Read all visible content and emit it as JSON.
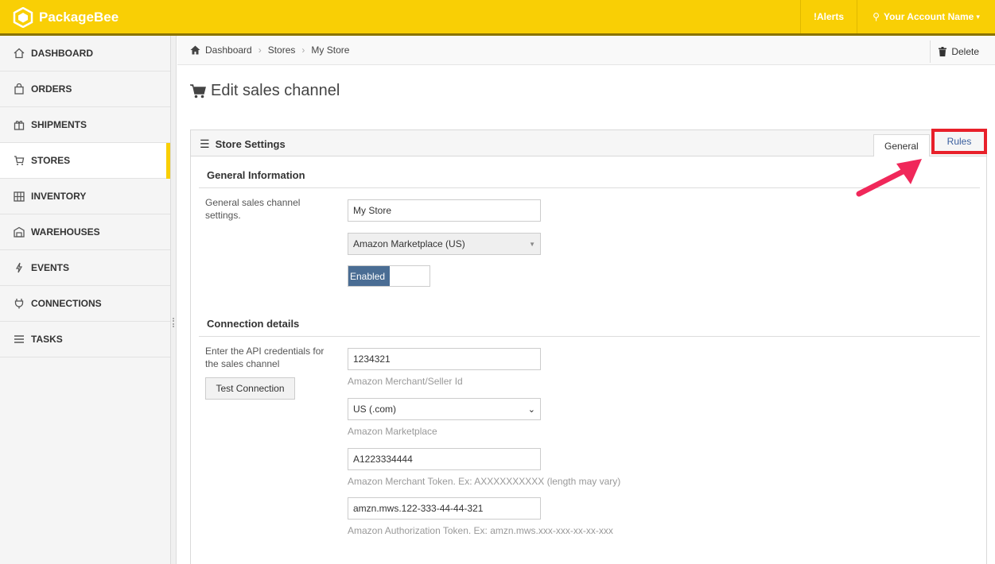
{
  "header": {
    "brand": "PackageBee",
    "alerts_label": "Alerts",
    "account_label": "Your Account Name",
    "brand_color": "#f9cf05"
  },
  "sidebar": {
    "items": [
      {
        "label": "DASHBOARD",
        "icon": "home-icon"
      },
      {
        "label": "ORDERS",
        "icon": "bag-icon"
      },
      {
        "label": "SHIPMENTS",
        "icon": "gift-icon"
      },
      {
        "label": "STORES",
        "icon": "cart-icon",
        "active": true
      },
      {
        "label": "INVENTORY",
        "icon": "inventory-icon"
      },
      {
        "label": "WAREHOUSES",
        "icon": "warehouse-icon"
      },
      {
        "label": "EVENTS",
        "icon": "bolt-icon"
      },
      {
        "label": "CONNECTIONS",
        "icon": "plug-icon"
      },
      {
        "label": "TASKS",
        "icon": "list-icon"
      }
    ]
  },
  "breadcrumb": [
    "Dashboard",
    "Stores",
    "My Store"
  ],
  "delete_label": "Delete",
  "page_title": "Edit sales channel",
  "panel": {
    "title": "Store Settings",
    "tabs": {
      "general": "General",
      "rules": "Rules"
    }
  },
  "general_info": {
    "title": "General Information",
    "hint": "General sales channel settings.",
    "store_name": "My Store",
    "channel": "Amazon Marketplace (US)",
    "toggle": "Enabled"
  },
  "connection": {
    "title": "Connection details",
    "hint": "Enter the API credentials for the sales channel",
    "test_button": "Test Connection",
    "merchant_id": "1234321",
    "merchant_id_help": "Amazon Merchant/Seller Id",
    "marketplace": "US (.com)",
    "marketplace_help": "Amazon Marketplace",
    "merchant_token": "A1223334444",
    "merchant_token_help": "Amazon Merchant Token. Ex: AXXXXXXXXXX (length may vary)",
    "auth_token": "amzn.mws.122-333-44-44-321",
    "auth_token_help": "Amazon Authorization Token. Ex: amzn.mws.xxx-xxx-xx-xx-xxx"
  },
  "annotation_color": "#e8202a"
}
